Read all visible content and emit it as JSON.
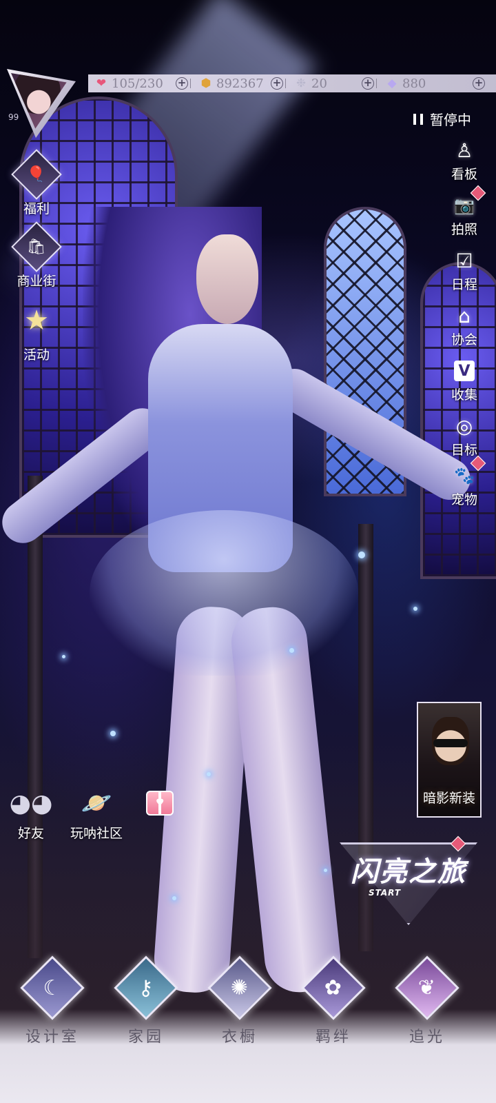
{
  "profile": {
    "level": "99"
  },
  "resources": [
    {
      "icon": "heart-gem-icon",
      "glyph": "❤",
      "color": "#e8577a",
      "value": "105/230"
    },
    {
      "icon": "gold-coin-icon",
      "glyph": "⬢",
      "color": "#e0a33a",
      "value": "892367"
    },
    {
      "icon": "crystal-flower-icon",
      "glyph": "❉",
      "color": "#c8c8d8",
      "value": "20"
    },
    {
      "icon": "diamond-icon",
      "glyph": "◆",
      "color": "#b8a8f0",
      "value": "880"
    }
  ],
  "status": {
    "label": "暂停中"
  },
  "left_menu": [
    {
      "name": "welfare",
      "label": "福利",
      "glyph": "🎈"
    },
    {
      "name": "shopping-street",
      "label": "商业街",
      "glyph": "🛍"
    },
    {
      "name": "events",
      "label": "活动",
      "glyph": "★"
    }
  ],
  "right_menu": [
    {
      "name": "showcase",
      "label": "看板",
      "glyph": "♙",
      "badge": false
    },
    {
      "name": "photo",
      "label": "拍照",
      "glyph": "📷",
      "badge": true
    },
    {
      "name": "schedule",
      "label": "日程",
      "glyph": "☑",
      "badge": false
    },
    {
      "name": "guild",
      "label": "协会",
      "glyph": "⌂",
      "badge": false
    },
    {
      "name": "collection",
      "label": "收集",
      "glyph": "V",
      "badge": false
    },
    {
      "name": "goals",
      "label": "目标",
      "glyph": "◎",
      "badge": false
    },
    {
      "name": "pets",
      "label": "宠物",
      "glyph": "🐾",
      "badge": true
    }
  ],
  "social": [
    {
      "name": "friends",
      "label": "好友"
    },
    {
      "name": "community",
      "label": "玩呐社区"
    },
    {
      "name": "gift",
      "label": ""
    }
  ],
  "event_card": {
    "title": "暗影新装"
  },
  "journey": {
    "title": "闪亮之旅",
    "subtitle": "START"
  },
  "bottom_nav": [
    {
      "name": "design-studio",
      "label": "设计室",
      "glyph": "☾",
      "color": "#6a6aa8"
    },
    {
      "name": "home",
      "label": "家园",
      "glyph": "⚷",
      "color": "#5a8aa8"
    },
    {
      "name": "wardrobe",
      "label": "衣橱",
      "glyph": "✺",
      "color": "#8a86b0"
    },
    {
      "name": "bonds",
      "label": "羁绊",
      "glyph": "✿",
      "color": "#7a6aa8"
    },
    {
      "name": "chase-light",
      "label": "追光",
      "glyph": "❦",
      "color": "#a87ac8"
    }
  ]
}
